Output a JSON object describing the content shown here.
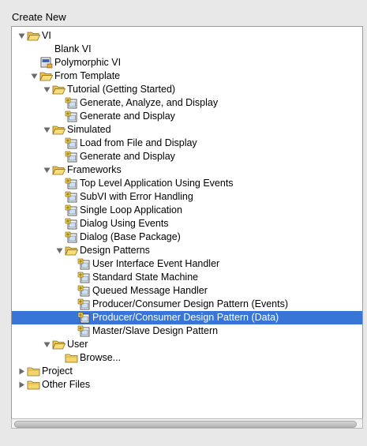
{
  "panel": {
    "title": "Create New"
  },
  "tree": [
    {
      "label": "VI",
      "depth": 0,
      "type": "folder",
      "expanded": true
    },
    {
      "label": "Blank VI",
      "depth": 1,
      "type": "vi"
    },
    {
      "label": "Polymorphic VI",
      "depth": 1,
      "type": "poly"
    },
    {
      "label": "From Template",
      "depth": 1,
      "type": "folder",
      "expanded": true
    },
    {
      "label": "Tutorial (Getting Started)",
      "depth": 2,
      "type": "folder",
      "expanded": true
    },
    {
      "label": "Generate, Analyze, and Display",
      "depth": 3,
      "type": "template"
    },
    {
      "label": "Generate and Display",
      "depth": 3,
      "type": "template"
    },
    {
      "label": "Simulated",
      "depth": 2,
      "type": "folder",
      "expanded": true
    },
    {
      "label": "Load from File and Display",
      "depth": 3,
      "type": "template"
    },
    {
      "label": "Generate and Display",
      "depth": 3,
      "type": "template"
    },
    {
      "label": "Frameworks",
      "depth": 2,
      "type": "folder",
      "expanded": true
    },
    {
      "label": "Top Level Application Using Events",
      "depth": 3,
      "type": "template"
    },
    {
      "label": "SubVI with Error Handling",
      "depth": 3,
      "type": "template"
    },
    {
      "label": "Single Loop Application",
      "depth": 3,
      "type": "template"
    },
    {
      "label": "Dialog Using Events",
      "depth": 3,
      "type": "template"
    },
    {
      "label": "Dialog (Base Package)",
      "depth": 3,
      "type": "template"
    },
    {
      "label": "Design Patterns",
      "depth": 3,
      "type": "folder",
      "expanded": true
    },
    {
      "label": "User Interface Event Handler",
      "depth": 4,
      "type": "template"
    },
    {
      "label": "Standard State Machine",
      "depth": 4,
      "type": "template"
    },
    {
      "label": "Queued Message Handler",
      "depth": 4,
      "type": "template"
    },
    {
      "label": "Producer/Consumer Design Pattern (Events)",
      "depth": 4,
      "type": "template"
    },
    {
      "label": "Producer/Consumer Design Pattern (Data)",
      "depth": 4,
      "type": "template",
      "selected": true
    },
    {
      "label": "Master/Slave Design Pattern",
      "depth": 4,
      "type": "template"
    },
    {
      "label": "User",
      "depth": 2,
      "type": "folder",
      "expanded": true
    },
    {
      "label": "Browse...",
      "depth": 3,
      "type": "folder-closed"
    },
    {
      "label": "Project",
      "depth": 0,
      "type": "folder",
      "expanded": false
    },
    {
      "label": "Other Files",
      "depth": 0,
      "type": "folder",
      "expanded": false
    }
  ],
  "colors": {
    "selection": "#3875d7",
    "folder": "#f3d56b",
    "folder_edge": "#8a6d1c"
  }
}
